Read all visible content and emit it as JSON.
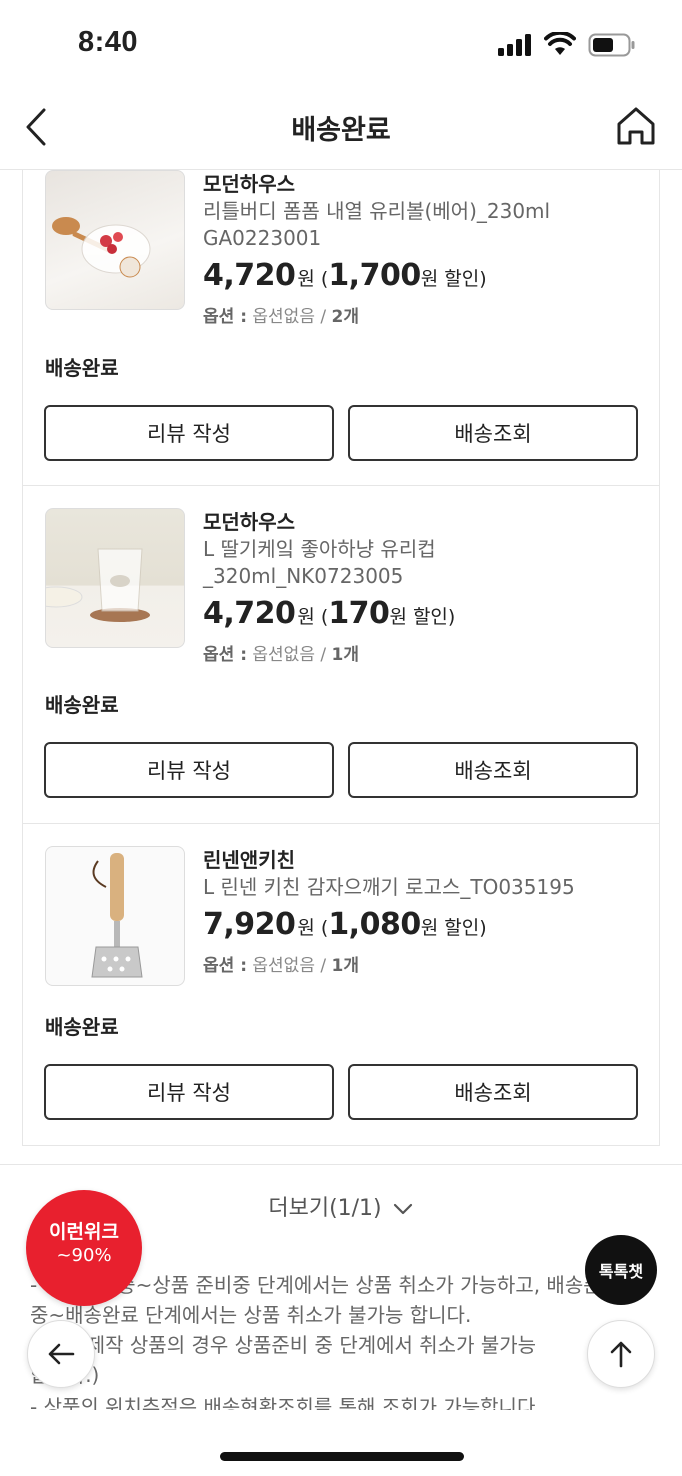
{
  "status_bar": {
    "time": "8:40"
  },
  "header": {
    "title": "배송완료"
  },
  "items": [
    {
      "brand": "모던하우스",
      "name_line1": "리틀버디 폼폼 내열 유리볼(베어)_230ml",
      "name_line2": "GA0223001",
      "price": "4,720",
      "currency": "원",
      "discount_open": "(",
      "discount": "1,700",
      "discount_suffix": "원 할인)",
      "option_label": "옵션 :",
      "option_value": "옵션없음 /",
      "qty": "2개",
      "status": "배송완료",
      "review_btn": "리뷰 작성",
      "track_btn": "배송조회",
      "image": "glass-bowl-product-photo"
    },
    {
      "brand": "모던하우스",
      "name_line1": "L 딸기케잌 좋아하냥 유리컵",
      "name_line2": "_320ml_NK0723005",
      "price": "4,720",
      "currency": "원",
      "discount_open": "(",
      "discount": "170",
      "discount_suffix": "원 할인)",
      "option_label": "옵션 :",
      "option_value": "옵션없음 /",
      "qty": "1개",
      "status": "배송완료",
      "review_btn": "리뷰 작성",
      "track_btn": "배송조회",
      "image": "glass-cup-product-photo"
    },
    {
      "brand": "린넨앤키친",
      "name_line1": "L 린넨 키친 감자으깨기 로고스_TO035195",
      "name_line2": "",
      "price": "7,920",
      "currency": "원",
      "discount_open": "(",
      "discount": "1,080",
      "discount_suffix": "원 할인)",
      "option_label": "옵션 :",
      "option_value": "옵션없음 /",
      "qty": "1개",
      "status": "배송완료",
      "review_btn": "리뷰 작성",
      "track_btn": "배송조회",
      "image": "potato-masher-product-photo"
    }
  ],
  "more": {
    "label": "더보기(1/1)"
  },
  "notice": [
    "- 주문접수중~상품 준비중 단계에서는 상품 취소가 가능하고, 배송준비",
    "중~배송완료 단계에서는 상품 취소가 불가능 합니다.",
    "- 주문 제작 상품의 경우 상품준비 중 단계에서 취소가 불가능",
    "합니다.)",
    "- 상품의 위치추적은 배송현황조회를 통해 조회가 가능합니다"
  ],
  "promo": {
    "line1": "이런위크",
    "line2": "~90%",
    "color": "#e8202e"
  },
  "chat": {
    "label": "톡톡챗"
  }
}
